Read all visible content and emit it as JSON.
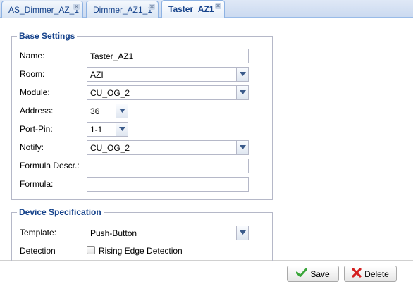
{
  "tabs": [
    {
      "label": "AS_Dimmer_AZ_1",
      "active": false
    },
    {
      "label": "Dimmer_AZ1_1",
      "active": false
    },
    {
      "label": "Taster_AZ1",
      "active": true
    }
  ],
  "base_settings": {
    "legend": "Base Settings",
    "name": {
      "label": "Name:",
      "value": "Taster_AZ1"
    },
    "room": {
      "label": "Room:",
      "value": "AZI"
    },
    "module": {
      "label": "Module:",
      "value": "CU_OG_2"
    },
    "address": {
      "label": "Address:",
      "value": "36"
    },
    "port_pin": {
      "label": "Port-Pin:",
      "value": "1-1"
    },
    "notify": {
      "label": "Notify:",
      "value": "CU_OG_2"
    },
    "formula_descr": {
      "label": "Formula Descr.:",
      "value": ""
    },
    "formula": {
      "label": "Formula:",
      "value": ""
    }
  },
  "device_spec": {
    "legend": "Device Specification",
    "template": {
      "label": "Template:",
      "value": "Push-Button"
    },
    "detection": {
      "label": "Detection",
      "checkbox_label": "Rising Edge Detection",
      "checked": false
    }
  },
  "buttons": {
    "save": "Save",
    "delete": "Delete"
  },
  "colors": {
    "accent": "#15428b",
    "tab_border": "#8db2e3",
    "field_border": "#b5b8c8",
    "save_icon": "#3aa63a",
    "delete_icon": "#d42020"
  }
}
